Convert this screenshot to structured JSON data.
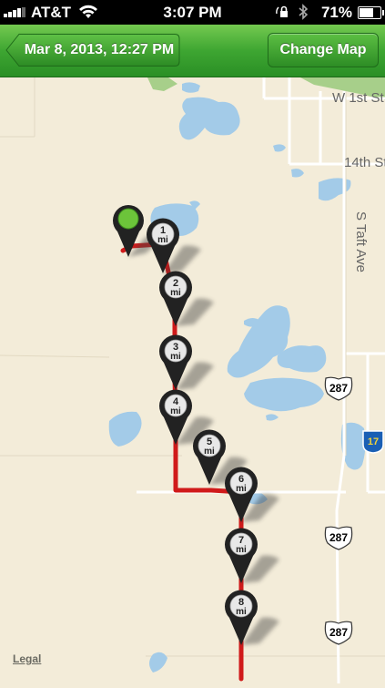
{
  "status": {
    "carrier": "AT&T",
    "time": "3:07 PM",
    "battery": "71%",
    "battery_level": 0.71
  },
  "nav": {
    "back_label": "Mar 8, 2013, 12:27 PM",
    "change_map_label": "Change Map"
  },
  "map": {
    "roads": [
      "W 1st St",
      "14th St",
      "S Taft Ave"
    ],
    "shields": [
      {
        "label": "287",
        "type": "us"
      },
      {
        "label": "17",
        "type": "state"
      },
      {
        "label": "287",
        "type": "us"
      },
      {
        "label": "287",
        "type": "us"
      }
    ],
    "mile_markers": [
      {
        "number": "1",
        "unit": "mi"
      },
      {
        "number": "2",
        "unit": "mi"
      },
      {
        "number": "3",
        "unit": "mi"
      },
      {
        "number": "4",
        "unit": "mi"
      },
      {
        "number": "5",
        "unit": "mi"
      },
      {
        "number": "6",
        "unit": "mi"
      },
      {
        "number": "7",
        "unit": "mi"
      },
      {
        "number": "8",
        "unit": "mi"
      }
    ],
    "legal_label": "Legal",
    "colors": {
      "route": "#d01a1a",
      "water": "#a3cbe8",
      "land": "#f3ecd9",
      "park": "#a7cf8a",
      "start_pin": "#6cc43a"
    }
  }
}
